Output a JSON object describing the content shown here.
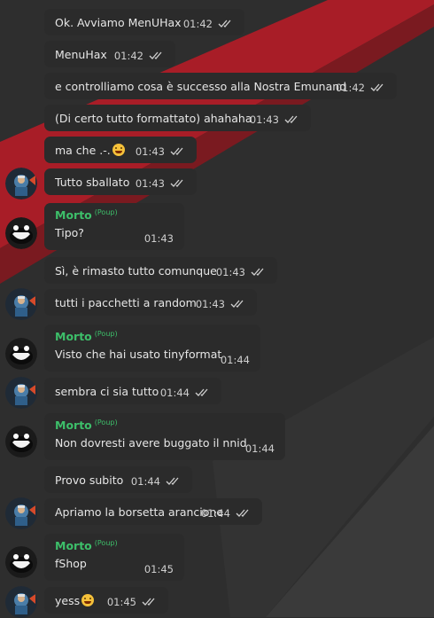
{
  "messages": [
    {
      "text": "Ok. Avviamo MenUHax",
      "time": "01:42"
    },
    {
      "text": "MenuHax",
      "time": "01:42"
    },
    {
      "text": "e controlliamo cosa è successo alla Nostra Emunand",
      "time": "01:42"
    },
    {
      "text": "(Di certo tutto formattato) ahahaha",
      "time": "01:43"
    },
    {
      "text": "ma che .-.",
      "time": "01:43",
      "emoji": "grinning-face-emoji"
    },
    {
      "text": "Tutto sballato",
      "time": "01:43"
    },
    {
      "sender": "Morto",
      "sender_tag": "(Poup)",
      "text": "Tipo?",
      "time": "01:43"
    },
    {
      "text": "Sì, è rimasto tutto comunque",
      "time": "01:43"
    },
    {
      "text": "tutti i pacchetti a random",
      "time": "01:43"
    },
    {
      "sender": "Morto",
      "sender_tag": "(Poup)",
      "text": "Visto che hai usato tinyformat",
      "time": "01:44"
    },
    {
      "text": "sembra ci sia tutto",
      "time": "01:44"
    },
    {
      "sender": "Morto",
      "sender_tag": "(Poup)",
      "text": "Non dovresti avere buggato il nnid",
      "time": "01:44"
    },
    {
      "text": "Provo subito",
      "time": "01:44"
    },
    {
      "text": "Apriamo la borsetta arancione",
      "time": "01:44"
    },
    {
      "sender": "Morto",
      "sender_tag": "(Poup)",
      "text": "fShop",
      "time": "01:45"
    },
    {
      "text": "yess",
      "time": "01:45",
      "emoji": "grinning-face-emoji"
    }
  ],
  "colors": {
    "background": "#2d2d2d",
    "bubble": "#2b2b2b",
    "sender_name": "#3dbf6a",
    "text": "#e6e6e6",
    "accent_stripe": "#b0202a"
  }
}
